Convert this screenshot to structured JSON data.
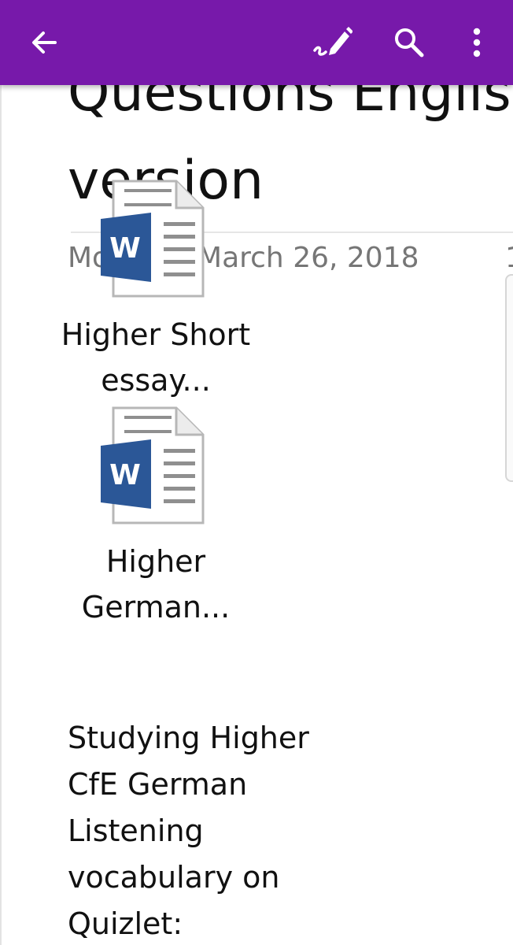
{
  "app_bar": {
    "color": "#7719aa",
    "back_icon": "arrow-left-icon",
    "draw_icon": "draw-pen-icon",
    "search_icon": "search-icon",
    "more_icon": "more-vertical-icon"
  },
  "page": {
    "title_lines": [
      "Questions Englis",
      "version"
    ],
    "date": "Monday, March 26, 2018",
    "time_peek": "1"
  },
  "attachments": [
    {
      "icon": "word-document-icon",
      "label_lines": [
        "Higher Short",
        "essay..."
      ]
    },
    {
      "icon": "word-document-icon",
      "label_lines": [
        "Higher",
        "German..."
      ]
    }
  ],
  "body_lines": [
    "Studying Higher",
    "CfE German",
    "Listening",
    "vocabulary on",
    "Quizlet:"
  ]
}
